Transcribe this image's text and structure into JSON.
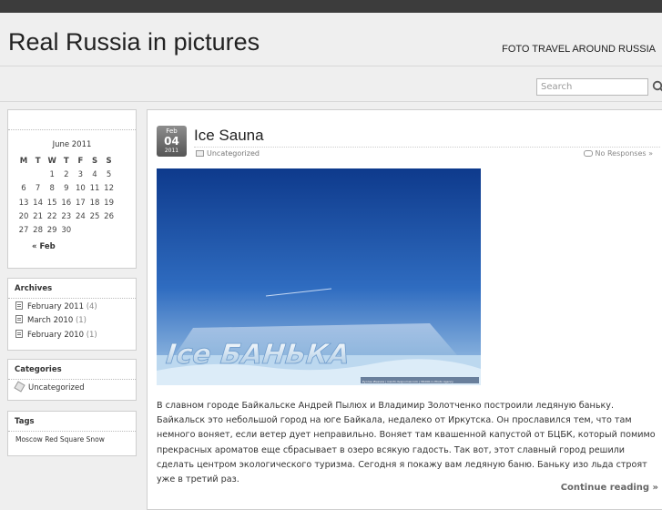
{
  "header": {
    "site_title": "Real Russia in pictures",
    "tagline": "FOTO TRAVEL AROUND RUSSIA",
    "search_placeholder": "Search"
  },
  "calendar": {
    "caption": "June 2011",
    "weekdays": [
      "M",
      "T",
      "W",
      "T",
      "F",
      "S",
      "S"
    ],
    "weeks": [
      [
        "",
        "",
        "1",
        "2",
        "3",
        "4",
        "5"
      ],
      [
        "6",
        "7",
        "8",
        "9",
        "10",
        "11",
        "12"
      ],
      [
        "13",
        "14",
        "15",
        "16",
        "17",
        "18",
        "19"
      ],
      [
        "20",
        "21",
        "22",
        "23",
        "24",
        "25",
        "26"
      ],
      [
        "27",
        "28",
        "29",
        "30",
        "",
        "",
        ""
      ]
    ],
    "prev_label": "« Feb"
  },
  "archives": {
    "title": "Archives",
    "items": [
      {
        "label": "February 2011",
        "count": "(4)"
      },
      {
        "label": "March 2010",
        "count": "(1)"
      },
      {
        "label": "February 2010",
        "count": "(1)"
      }
    ]
  },
  "categories": {
    "title": "Categories",
    "items": [
      "Uncategorized"
    ]
  },
  "tags": {
    "title": "Tags",
    "items": [
      "Moscow",
      "Red Square",
      "Snow"
    ]
  },
  "post": {
    "date_month": "Feb",
    "date_day": "04",
    "date_year": "2011",
    "title": "Ice Sauna",
    "category": "Uncategorized",
    "responses": "No Responses »",
    "image_text": "Ice БАНЬКА",
    "image_credit": "Руслан Имамов | iceinfo.livejournal.com | 38.000.ru Photo Agency",
    "body": "В славном городе Байкальске Андрей Пылюх и Владимир Золотченко построили ледяную баньку. Байкальск это небольшой город на юге Байкала, недалеко от Иркутска. Он прославился тем, что там немного воняет, если ветер дует неправильно. Воняет там квашенной капустой от БЦБК, который помимо прекрасных ароматов еще сбрасывает в озеро всякую гадость. Так вот, этот славный город решили сделать центром экологического туризма. Сегодня я покажу вам ледяную баню. Баньку изо льда строят уже в третий раз.",
    "continue_label": "Continue reading »"
  },
  "colors": {
    "topbar": "#3c3c3c",
    "background": "#efefef",
    "sky_top": "#123f8f",
    "sky_bottom": "#9fc4e6"
  }
}
